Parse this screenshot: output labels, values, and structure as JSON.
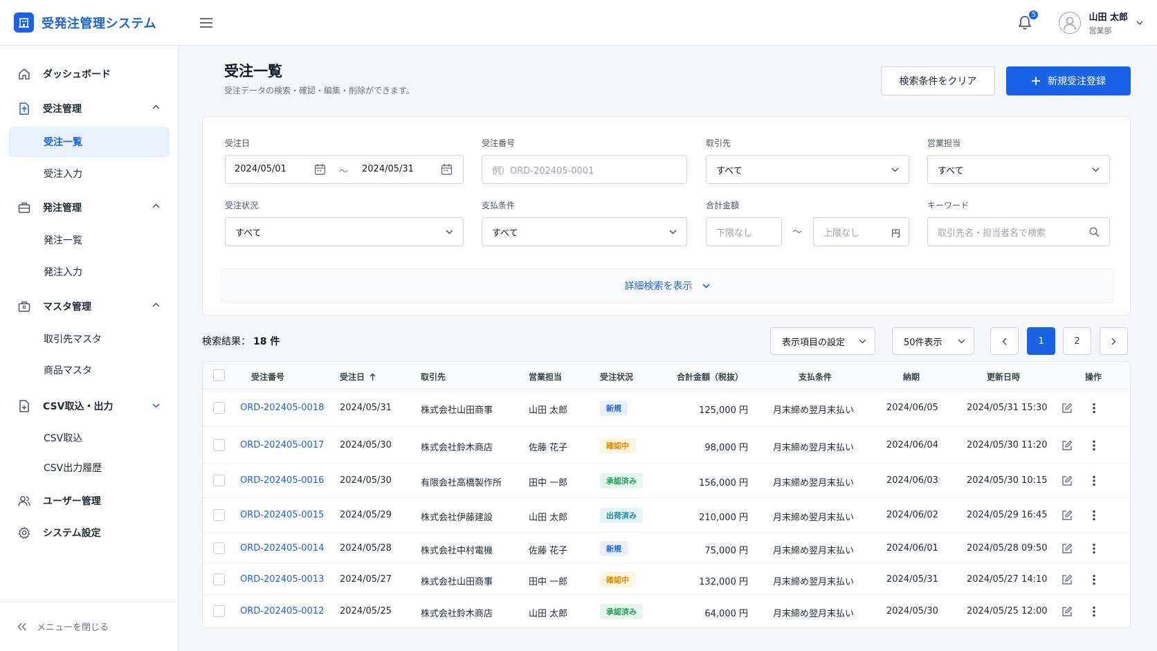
{
  "app": {
    "title": "受発注管理システム"
  },
  "header": {
    "notification_count": "5",
    "user_name": "山田 太郎",
    "user_dept": "営業部"
  },
  "sidebar": {
    "dashboard": "ダッシュボード",
    "order_mgmt": "受注管理",
    "order_list": "受注一覧",
    "order_entry": "受注入力",
    "purchase_mgmt": "発注管理",
    "purchase_list": "発注一覧",
    "purchase_entry": "発注入力",
    "master_mgmt": "マスタ管理",
    "client_master": "取引先マスタ",
    "product_master": "商品マスタ",
    "csv": "CSV取込・出力",
    "csv_import": "CSV取込",
    "csv_export_history": "CSV出力履歴",
    "user_mgmt": "ユーザー管理",
    "system_settings": "システム設定",
    "collapse": "メニューを閉じる"
  },
  "page": {
    "title": "受注一覧",
    "subtitle": "受注データの検索・確認・編集・削除ができます。",
    "clear_button": "検索条件をクリア",
    "new_button": "新規受注登録"
  },
  "filters": {
    "order_date_label": "受注日",
    "date_from": "2024/05/01",
    "date_to": "2024/05/31",
    "tilde": "〜",
    "order_no_label": "受注番号",
    "order_no_placeholder": "例）ORD-202405-0001",
    "client_label": "取引先",
    "client_value": "すべて",
    "sales_label": "営業担当",
    "sales_value": "すべて",
    "status_label": "受注状況",
    "status_value": "すべて",
    "payment_label": "支払条件",
    "payment_value": "すべて",
    "amount_label": "合計金額",
    "amount_min_placeholder": "下限なし",
    "amount_max_placeholder": "上限なし",
    "yen": "円",
    "keyword_label": "キーワード",
    "keyword_placeholder": "取引先名・担当者名で検索",
    "advanced_toggle": "詳細検索を表示"
  },
  "results": {
    "label": "検索結果：",
    "count": "18 件",
    "column_settings": "表示項目の設定",
    "page_size": "50件表示",
    "pages": [
      "1",
      "2"
    ],
    "current_page": "1"
  },
  "table": {
    "headers": {
      "order_no": "受注番号",
      "order_date": "受注日",
      "client": "取引先",
      "sales": "営業担当",
      "status": "受注状況",
      "total": "合計金額（税抜）",
      "payment": "支払条件",
      "due": "納期",
      "updated": "更新日時",
      "actions": "操作"
    },
    "status_colors": {
      "新規": {
        "bg": "#e8f0fe",
        "fg": "#1a63e6"
      },
      "確認中": {
        "bg": "#fff4e0",
        "fg": "#e08a00"
      },
      "承認済み": {
        "bg": "#e3f6ec",
        "fg": "#1f9d55"
      },
      "出荷済み": {
        "bg": "#e2f4f7",
        "fg": "#138a9e"
      }
    },
    "rows": [
      {
        "order_no": "ORD-202405-0018",
        "order_date": "2024/05/31",
        "client": "株式会社山田商事",
        "sales": "山田 太郎",
        "status": "新規",
        "total": "125,000 円",
        "payment": "月末締め翌月末払い",
        "due": "2024/06/05",
        "updated": "2024/05/31 15:30"
      },
      {
        "order_no": "ORD-202405-0017",
        "order_date": "2024/05/30",
        "client": "株式会社鈴木商店",
        "sales": "佐藤 花子",
        "status": "確認中",
        "total": "98,000 円",
        "payment": "月末締め翌月末払い",
        "due": "2024/06/04",
        "updated": "2024/05/30 11:20"
      },
      {
        "order_no": "ORD-202405-0016",
        "order_date": "2024/05/30",
        "client": "有限会社高橋製作所",
        "sales": "田中 一郎",
        "status": "承認済み",
        "total": "156,000 円",
        "payment": "月末締め翌月末払い",
        "due": "2024/06/03",
        "updated": "2024/05/30 10:15"
      },
      {
        "order_no": "ORD-202405-0015",
        "order_date": "2024/05/29",
        "client": "株式会社伊藤建設",
        "sales": "山田 太郎",
        "status": "出荷済み",
        "total": "210,000 円",
        "payment": "月末締め翌月末払い",
        "due": "2024/06/02",
        "updated": "2024/05/29 16:45"
      },
      {
        "order_no": "ORD-202405-0014",
        "order_date": "2024/05/28",
        "client": "株式会社中村電機",
        "sales": "佐藤 花子",
        "status": "新規",
        "total": "75,000 円",
        "payment": "月末締め翌月末払い",
        "due": "2024/06/01",
        "updated": "2024/05/28 09:50"
      },
      {
        "order_no": "ORD-202405-0013",
        "order_date": "2024/05/27",
        "client": "株式会社山田商事",
        "sales": "田中 一郎",
        "status": "確認中",
        "total": "132,000 円",
        "payment": "月末締め翌月末払い",
        "due": "2024/05/31",
        "updated": "2024/05/27 14:10"
      },
      {
        "order_no": "ORD-202405-0012",
        "order_date": "2024/05/25",
        "client": "株式会社鈴木商店",
        "sales": "山田 太郎",
        "status": "承認済み",
        "total": "64,000 円",
        "payment": "月末締め翌月末払い",
        "due": "2024/05/30",
        "updated": "2024/05/25 12:00"
      }
    ]
  }
}
